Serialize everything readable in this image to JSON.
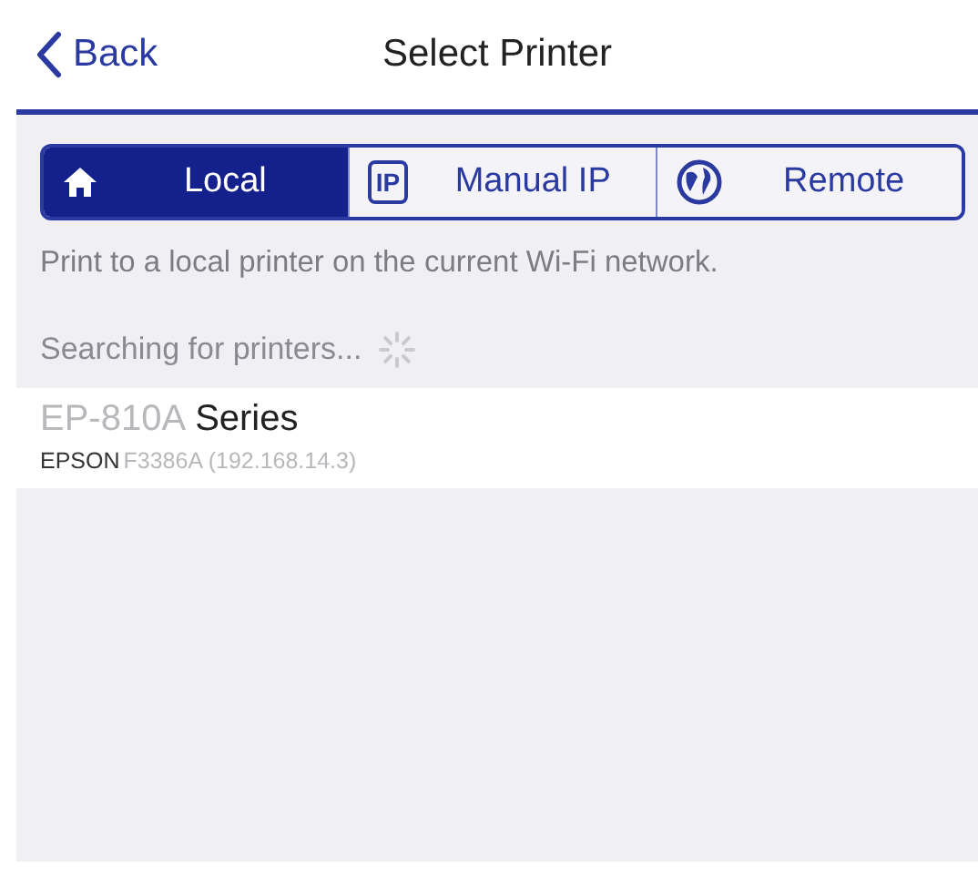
{
  "nav": {
    "back": "Back",
    "title": "Select Printer"
  },
  "tabs": [
    {
      "label": "Local",
      "kind": "home",
      "selected": true
    },
    {
      "label": "Manual IP",
      "kind": "badge",
      "badge": "IP",
      "selected": false
    },
    {
      "label": "Remote",
      "kind": "globe",
      "selected": false
    }
  ],
  "description": "Print to a local printer on the current Wi-Fi network.",
  "status": {
    "text": "Searching for printers...",
    "busy": true
  },
  "printers": [
    {
      "name_prefix": "EP-810A",
      "name": "Series",
      "id_prefix": "EPSON",
      "id": "F3386A (192.168.14.3)"
    }
  ]
}
